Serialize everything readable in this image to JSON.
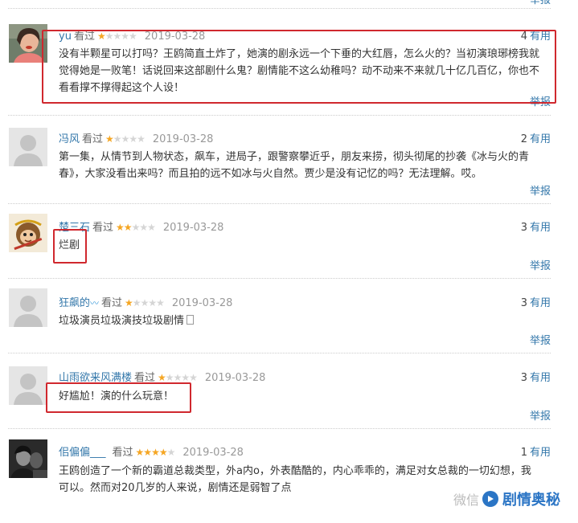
{
  "top_report_label": "举报",
  "watched_label": "看过",
  "useful_label": "有用",
  "report_label": "举报",
  "comments": [
    {
      "user": "yu",
      "rating": 1,
      "date": "2019-03-28",
      "useful_count": "4",
      "text": "没有半颗星可以打吗？王鸥简直土炸了，她演的剧永远一个下垂的大红唇，怎么火的？当初演琅琊榜我就觉得她是一败笔！话说回来这部剧什么鬼？剧情能不这么幼稚吗？动不动来不来就几十亿几百亿，你也不看看撑不撑得起这个人设！",
      "avatar_icon": "woman-photo-avatar"
    },
    {
      "user": "冯风",
      "rating": 1,
      "date": "2019-03-28",
      "useful_count": "2",
      "text": "第一集，从情节到人物状态，飙车，进局子，跟警察攀近乎，朋友来捞，彻头彻尾的抄袭《冰与火的青春》，大家没看出来吗？而且拍的远不如冰与火自然。贾少是没有记忆的吗？无法理解。哎。",
      "avatar_icon": "default-user-avatar"
    },
    {
      "user": "楚三石",
      "rating": 2,
      "date": "2019-03-28",
      "useful_count": "3",
      "text": "烂剧",
      "avatar_icon": "monkey-king-avatar"
    },
    {
      "user": "狂飙的",
      "rating": 1,
      "date": "2019-03-28",
      "useful_count": "3",
      "text": "垃圾演员垃圾演技垃圾剧情",
      "avatar_icon": "default-user-avatar"
    },
    {
      "user": "山雨欲来风满楼",
      "rating": 1,
      "date": "2019-03-28",
      "useful_count": "3",
      "text": "好尴尬！演的什么玩意！",
      "avatar_icon": "default-user-avatar"
    },
    {
      "user": "佀偏偏___",
      "rating": 4,
      "date": "2019-03-28",
      "useful_count": "1",
      "text": "王鸥创造了一个新的霸道总裁类型，外a内o，外表酷酷的，内心乖乖的，满足对女总裁的一切幻想，我可以。然而对20几岁的人来说，剧情还是弱智了点",
      "avatar_icon": "dark-photo-avatar"
    }
  ],
  "watermark": {
    "prefix": "微信",
    "brand": "剧情奥秘"
  },
  "colors": {
    "link": "#3377aa",
    "star_on": "#f5a623",
    "star_off": "#d5d5d5",
    "highlight_box": "#d0282e",
    "watermark": "#2b75c5"
  }
}
